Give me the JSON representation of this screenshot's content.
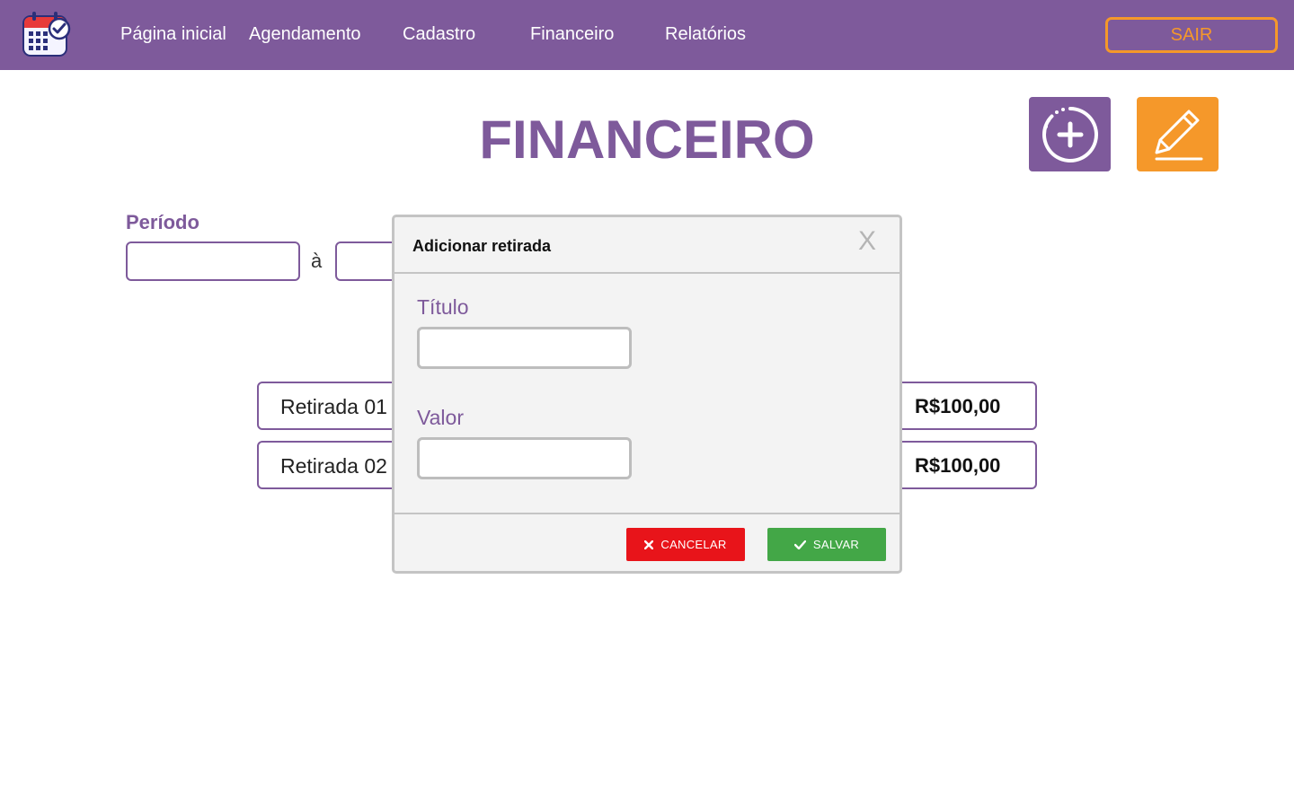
{
  "nav": {
    "items": [
      {
        "label": "Página inicial"
      },
      {
        "label": "Agendamento"
      },
      {
        "label": "Cadastro"
      },
      {
        "label": "Financeiro"
      },
      {
        "label": "Relatórios"
      }
    ],
    "logout_label": "SAIR"
  },
  "page": {
    "title": "FINANCEIRO",
    "periodo_label": "Período",
    "date_separator": "à",
    "start_date_value": "",
    "end_date_value": ""
  },
  "withdrawals": [
    {
      "title": "Retirada 01",
      "value": "R$100,00"
    },
    {
      "title": "Retirada 02",
      "value": "R$100,00"
    }
  ],
  "modal": {
    "title": "Adicionar retirada",
    "close_label": "X",
    "fields": {
      "titulo_label": "Título",
      "titulo_value": "",
      "valor_label": "Valor",
      "valor_value": ""
    },
    "cancel_label": "CANCELAR",
    "save_label": "SALVAR"
  },
  "icons": {
    "logo": "calendar-check-icon",
    "add": "plus-circle-icon",
    "edit": "pencil-icon",
    "cancel": "x-icon",
    "save": "check-icon"
  },
  "colors": {
    "primary": "#7e5a9b",
    "accent": "#f5982a",
    "danger": "#e8141a",
    "success": "#43a747"
  }
}
